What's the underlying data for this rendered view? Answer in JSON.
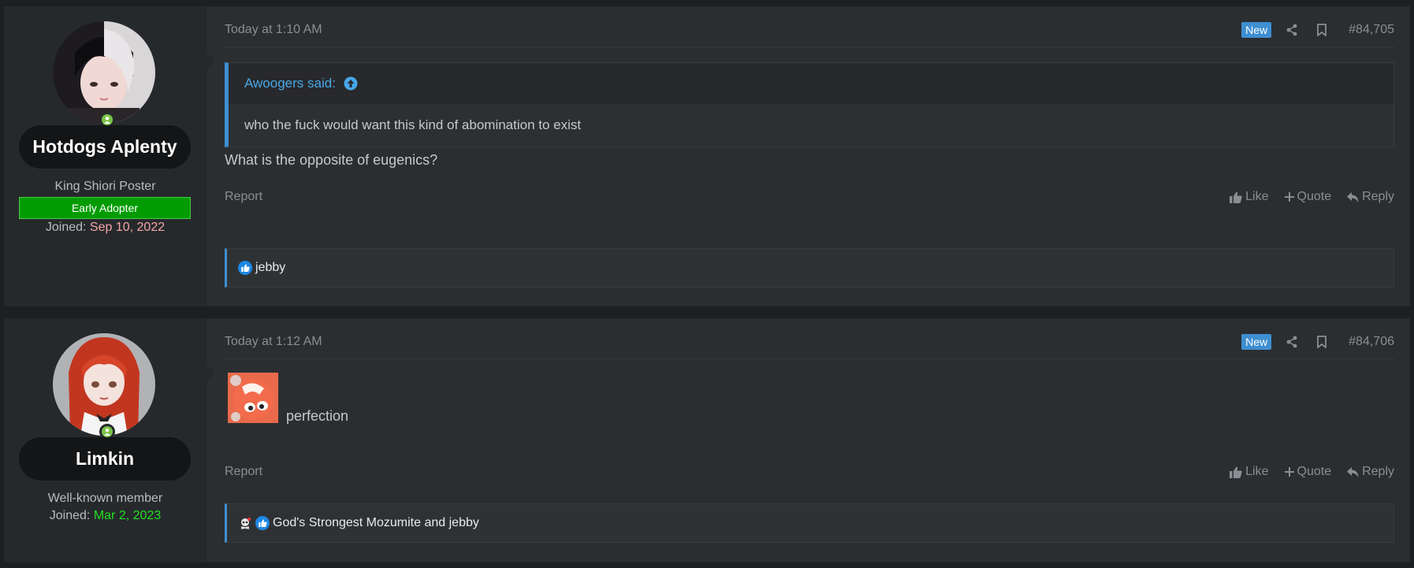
{
  "posts": [
    {
      "author": {
        "name": "Hotdogs Aplenty",
        "title": "King Shiori Poster",
        "banner": "Early Adopter",
        "joined_label": "Joined:",
        "joined_date": "Sep 10, 2022",
        "joined_color": "#f3a6a6"
      },
      "timestamp": "Today at 1:10 AM",
      "badge": "New",
      "post_number": "#84,705",
      "quote": {
        "author": "Awoogers said:",
        "text": "who the fuck would want this kind of abomination to exist"
      },
      "message": "What is the opposite of eugenics?",
      "report": "Report",
      "actions": {
        "like": "Like",
        "quote": "Quote",
        "reply": "Reply"
      },
      "reactions": "jebby"
    },
    {
      "author": {
        "name": "Limkin",
        "title": "Well-known member",
        "joined_label": "Joined:",
        "joined_date": "Mar 2, 2023",
        "joined_color": "#22e022"
      },
      "timestamp": "Today at 1:12 AM",
      "badge": "New",
      "post_number": "#84,706",
      "message": "perfection",
      "report": "Report",
      "actions": {
        "like": "Like",
        "quote": "Quote",
        "reply": "Reply"
      },
      "reactions": "God's Strongest Mozumite and jebby"
    }
  ],
  "colors": {
    "accent": "#3e8fd1",
    "link": "#48a8e8",
    "online": "#7bc34a",
    "banner_green": "#029c02"
  }
}
